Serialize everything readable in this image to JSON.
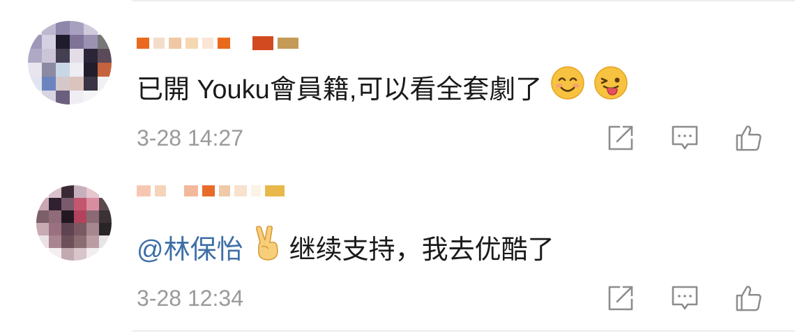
{
  "comments": [
    {
      "username": "",
      "text": "已開 Youku會員籍,可以看全套劇了",
      "emojis": [
        "smiling-face-icon",
        "winking-tongue-face-icon"
      ],
      "timestamp": "3-28 14:27",
      "actions": [
        "share-icon",
        "reply-icon",
        "like-icon"
      ]
    },
    {
      "username": "",
      "mention": "@林保怡",
      "text": "继续支持，我去优酷了",
      "emojis": [
        "victory-hand-icon"
      ],
      "timestamp": "3-28 12:34",
      "actions": [
        "share-icon",
        "reply-icon",
        "like-icon"
      ]
    }
  ],
  "colors": {
    "text": "#1a1a1a",
    "meta": "#9a9a9a",
    "mention": "#3e6ea7",
    "divider": "#ececec",
    "icon": "#8c8c8c"
  }
}
